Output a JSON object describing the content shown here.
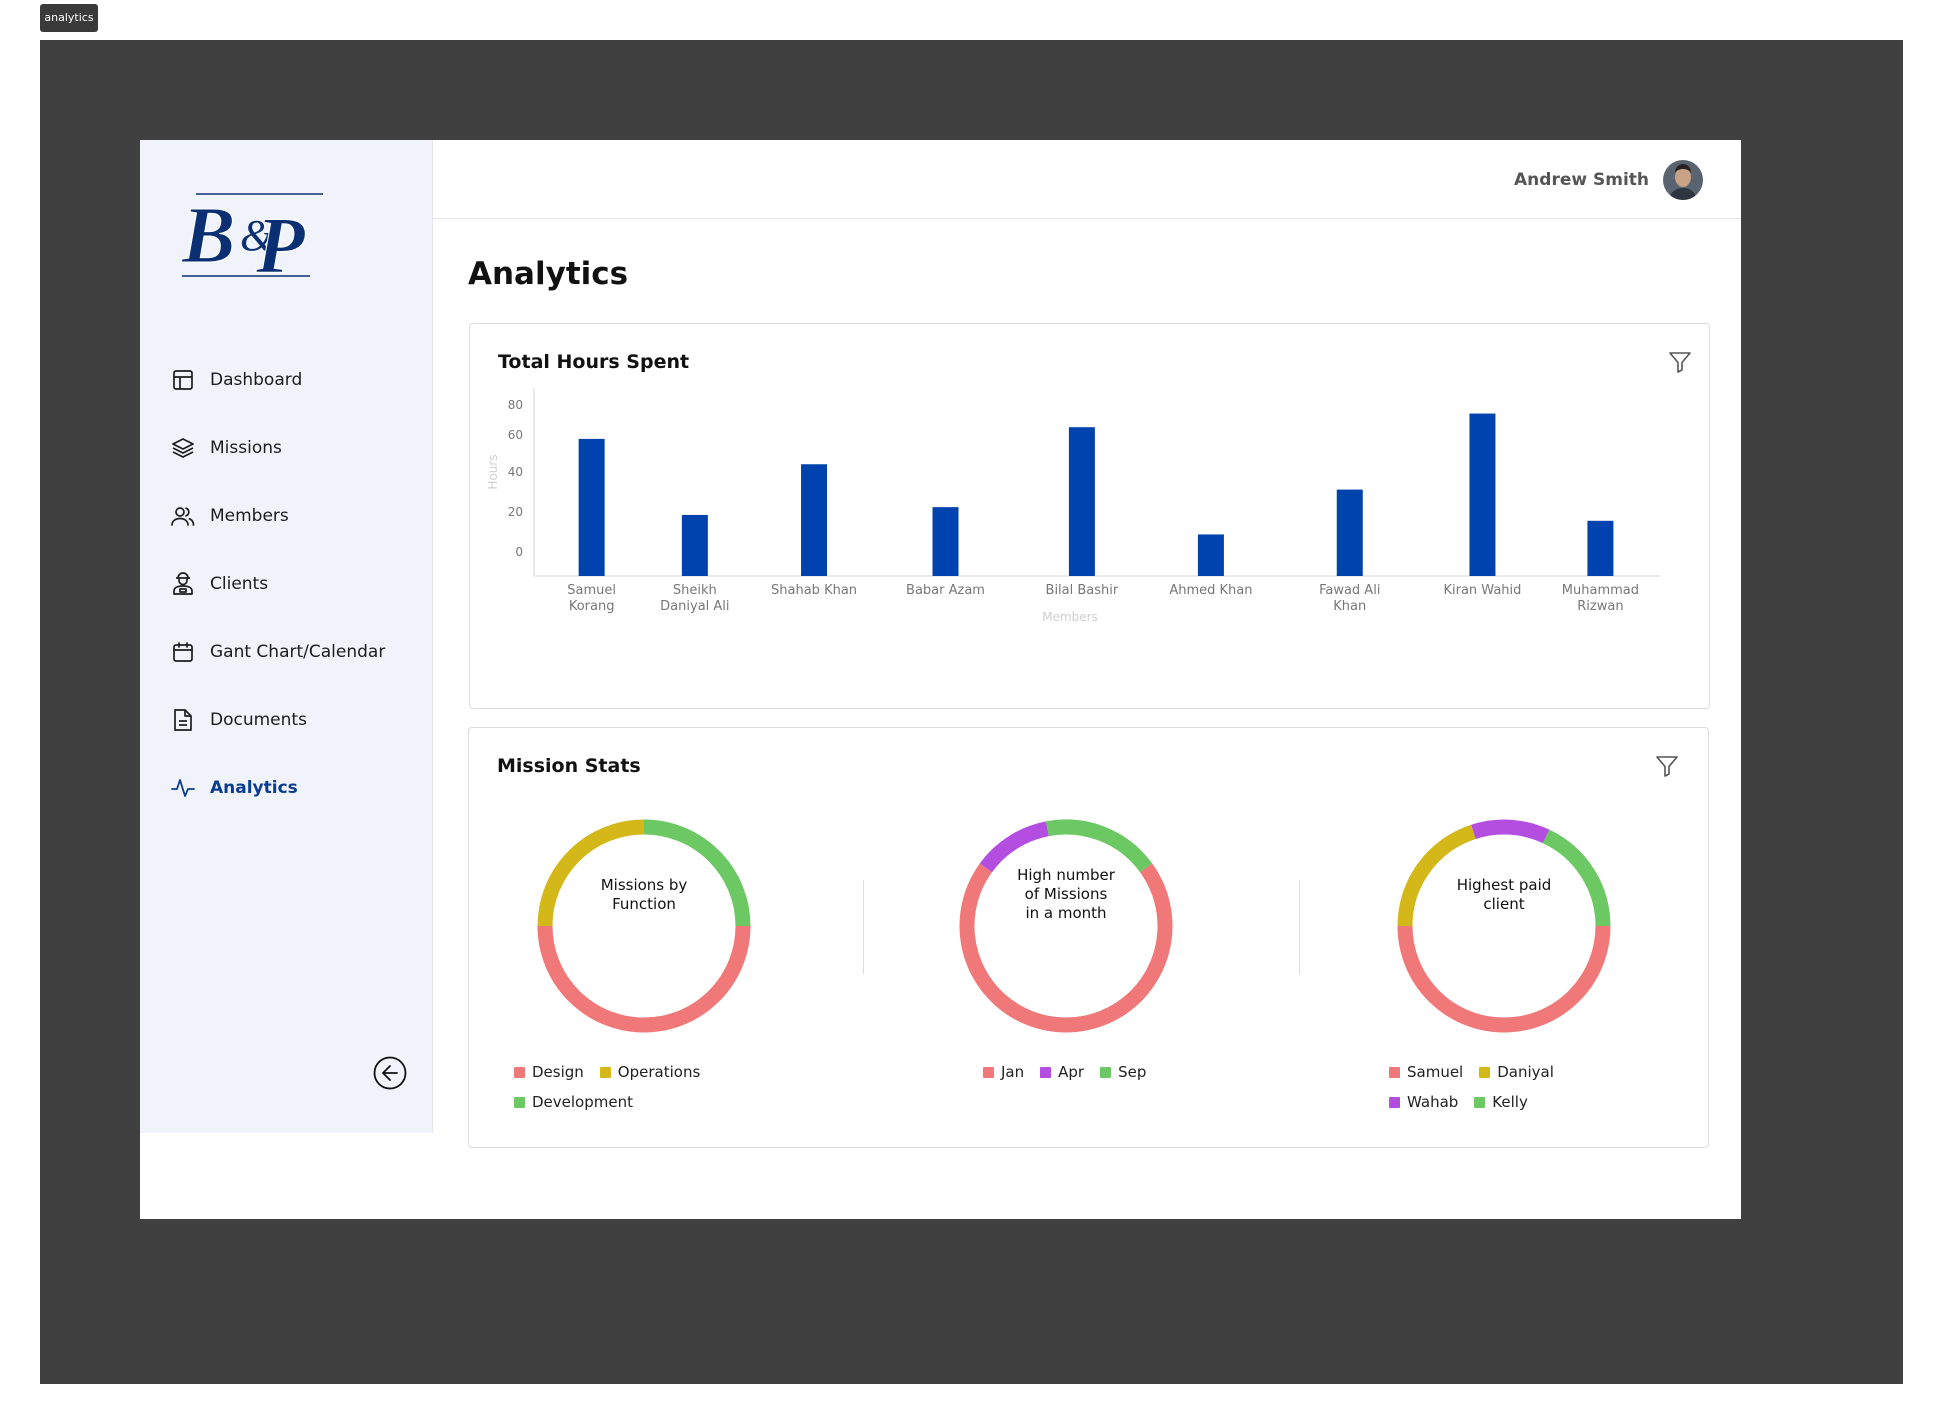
{
  "frame_label": "analytics",
  "brand": {
    "logo_text_b": "B",
    "logo_text_amp": "&",
    "logo_text_p": "P"
  },
  "sidebar": {
    "items": [
      {
        "label": "Dashboard",
        "icon": "layout-icon",
        "active": false
      },
      {
        "label": "Missions",
        "icon": "layers-icon",
        "active": false
      },
      {
        "label": "Members",
        "icon": "users-icon",
        "active": false
      },
      {
        "label": "Clients",
        "icon": "client-icon",
        "active": false
      },
      {
        "label": "Gant Chart/Calendar",
        "icon": "calendar-icon",
        "active": false
      },
      {
        "label": "Documents",
        "icon": "document-icon",
        "active": false
      },
      {
        "label": "Analytics",
        "icon": "activity-icon",
        "active": true
      }
    ],
    "collapse_icon": "arrow-left-circle-icon"
  },
  "header": {
    "user_name": "Andrew Smith"
  },
  "page": {
    "title": "Analytics"
  },
  "hours_card": {
    "title": "Total Hours Spent",
    "filter_icon": "filter-icon"
  },
  "stats_card": {
    "title": "Mission Stats",
    "filter_icon": "filter-icon"
  },
  "colors": {
    "bar": "#0043ae",
    "accent": "#0a3d91",
    "coral": "#f07878",
    "yellow": "#d4b81a",
    "green": "#6cc862",
    "purple": "#b44ee0"
  },
  "chart_data": [
    {
      "type": "bar",
      "title": "Total Hours Spent",
      "xlabel": "Members",
      "ylabel": "Hours",
      "y_ticks": [
        "80",
        "60",
        "40",
        "20",
        "0"
      ],
      "categories": [
        "Samuel Korang",
        "Sheikh Daniyal Ali",
        "Shahab Khan",
        "Babar Azam",
        "Bilal Bashir",
        "Ahmed Khan",
        "Fawad Ali Khan",
        "Kiran Wahid",
        "Muhammad Rizwan"
      ],
      "category_lines": [
        [
          "Samuel",
          "Korang"
        ],
        [
          "Sheikh",
          "Daniyal Ali"
        ],
        [
          "Shahab Khan"
        ],
        [
          "Babar Azam"
        ],
        [
          "Bilal Bashir"
        ],
        [
          "Ahmed Khan"
        ],
        [
          "Fawad Ali",
          "Khan"
        ],
        [
          "Kiran Wahid"
        ],
        [
          "Muhammad",
          "Rizwan"
        ]
      ],
      "values": [
        58,
        19,
        45,
        23,
        64,
        9,
        32,
        71,
        16
      ],
      "grid": false
    },
    {
      "type": "pie",
      "title": "Missions by Function",
      "center_lines": [
        "Missions by",
        "Function"
      ],
      "slices": [
        {
          "label": "Design",
          "value": 50,
          "color": "#f07878"
        },
        {
          "label": "Operations",
          "value": 25,
          "color": "#d4b81a"
        },
        {
          "label": "Development",
          "value": 25,
          "color": "#6cc862"
        }
      ]
    },
    {
      "type": "pie",
      "title": "High number of Missions in a month",
      "center_lines": [
        "High number",
        "of Missions",
        "in a month"
      ],
      "slices": [
        {
          "label": "Jan",
          "value": 70,
          "color": "#f07878"
        },
        {
          "label": "Apr",
          "value": 12,
          "color": "#b44ee0"
        },
        {
          "label": "Sep",
          "value": 18,
          "color": "#6cc862"
        }
      ]
    },
    {
      "type": "pie",
      "title": "Highest paid client",
      "center_lines": [
        "Highest paid",
        "client"
      ],
      "slices": [
        {
          "label": "Samuel",
          "value": 50,
          "color": "#f07878"
        },
        {
          "label": "Daniyal",
          "value": 20,
          "color": "#d4b81a"
        },
        {
          "label": "Wahab",
          "value": 12,
          "color": "#b44ee0"
        },
        {
          "label": "Kelly",
          "value": 18,
          "color": "#6cc862"
        }
      ]
    }
  ]
}
